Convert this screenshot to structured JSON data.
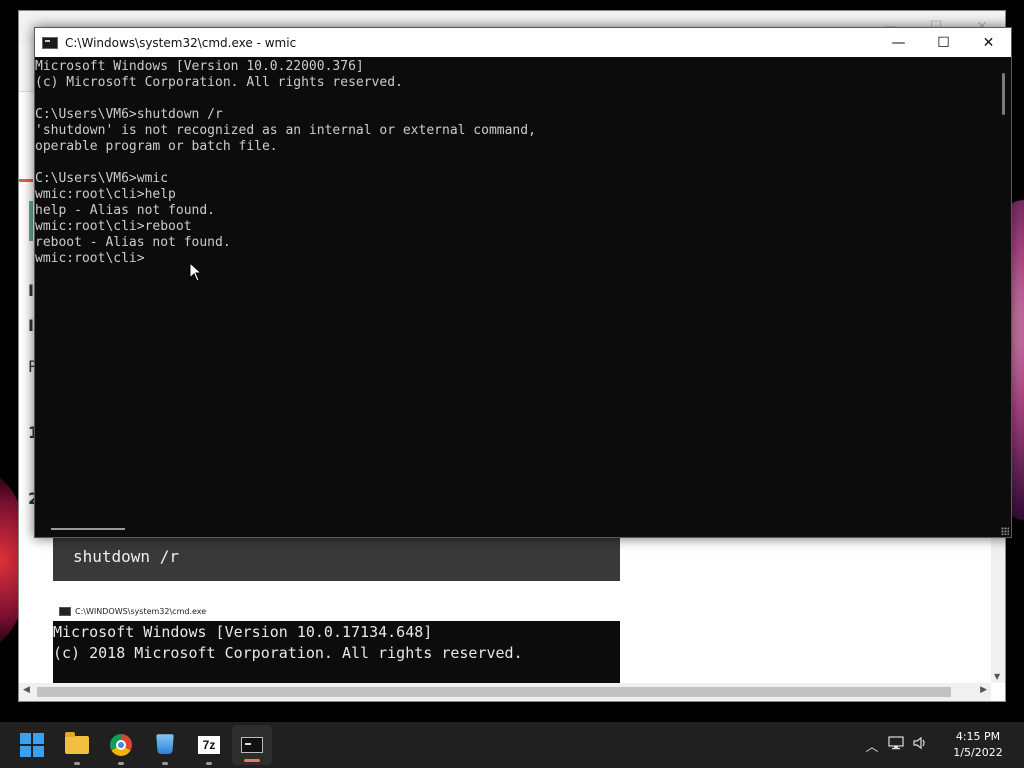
{
  "cmd_window": {
    "title": "C:\\Windows\\system32\\cmd.exe - wmic",
    "lines": [
      "Microsoft Windows [Version 10.0.22000.376]",
      "(c) Microsoft Corporation. All rights reserved.",
      "",
      "C:\\Users\\VM6>shutdown /r",
      "'shutdown' is not recognized as an internal or external command,",
      "operable program or batch file.",
      "",
      "C:\\Users\\VM6>wmic",
      "wmic:root\\cli>help",
      "help - Alias not found.",
      "wmic:root\\cli>reboot",
      "reboot - Alias not found.",
      "wmic:root\\cli>"
    ],
    "controls": {
      "minimize": "—",
      "maximize": "☐",
      "close": "✕"
    }
  },
  "browser": {
    "partial_left_label": "R",
    "side_glyphs": [
      "I",
      "I",
      "R",
      "1",
      "2"
    ],
    "code_box": "shutdown /r",
    "cmd_screenshot": {
      "title": "C:\\WINDOWS\\system32\\cmd.exe",
      "lines": [
        "Microsoft Windows [Version 10.0.17134.648]",
        "(c) 2018 Microsoft Corporation. All rights reserved."
      ]
    }
  },
  "taskbar": {
    "apps": [
      {
        "name": "start",
        "icon": "windows-icon",
        "running": false
      },
      {
        "name": "file-explorer",
        "icon": "folder-icon",
        "running": true
      },
      {
        "name": "chrome",
        "icon": "chrome-icon",
        "running": true
      },
      {
        "name": "bucket-app",
        "icon": "bucket-icon",
        "running": true
      },
      {
        "name": "7zip",
        "icon": "7z-icon",
        "label": "7z",
        "running": true
      },
      {
        "name": "terminal",
        "icon": "terminal-icon",
        "running": true,
        "active": true
      }
    ],
    "tray": {
      "time": "4:15 PM",
      "date": "1/5/2022"
    }
  },
  "colors": {
    "console_bg": "#0c0c0c",
    "console_text": "#cccccc",
    "taskbar_bg": "#202020",
    "windows_blue": "#3aa0f0",
    "active_indicator": "#e87a5c"
  }
}
